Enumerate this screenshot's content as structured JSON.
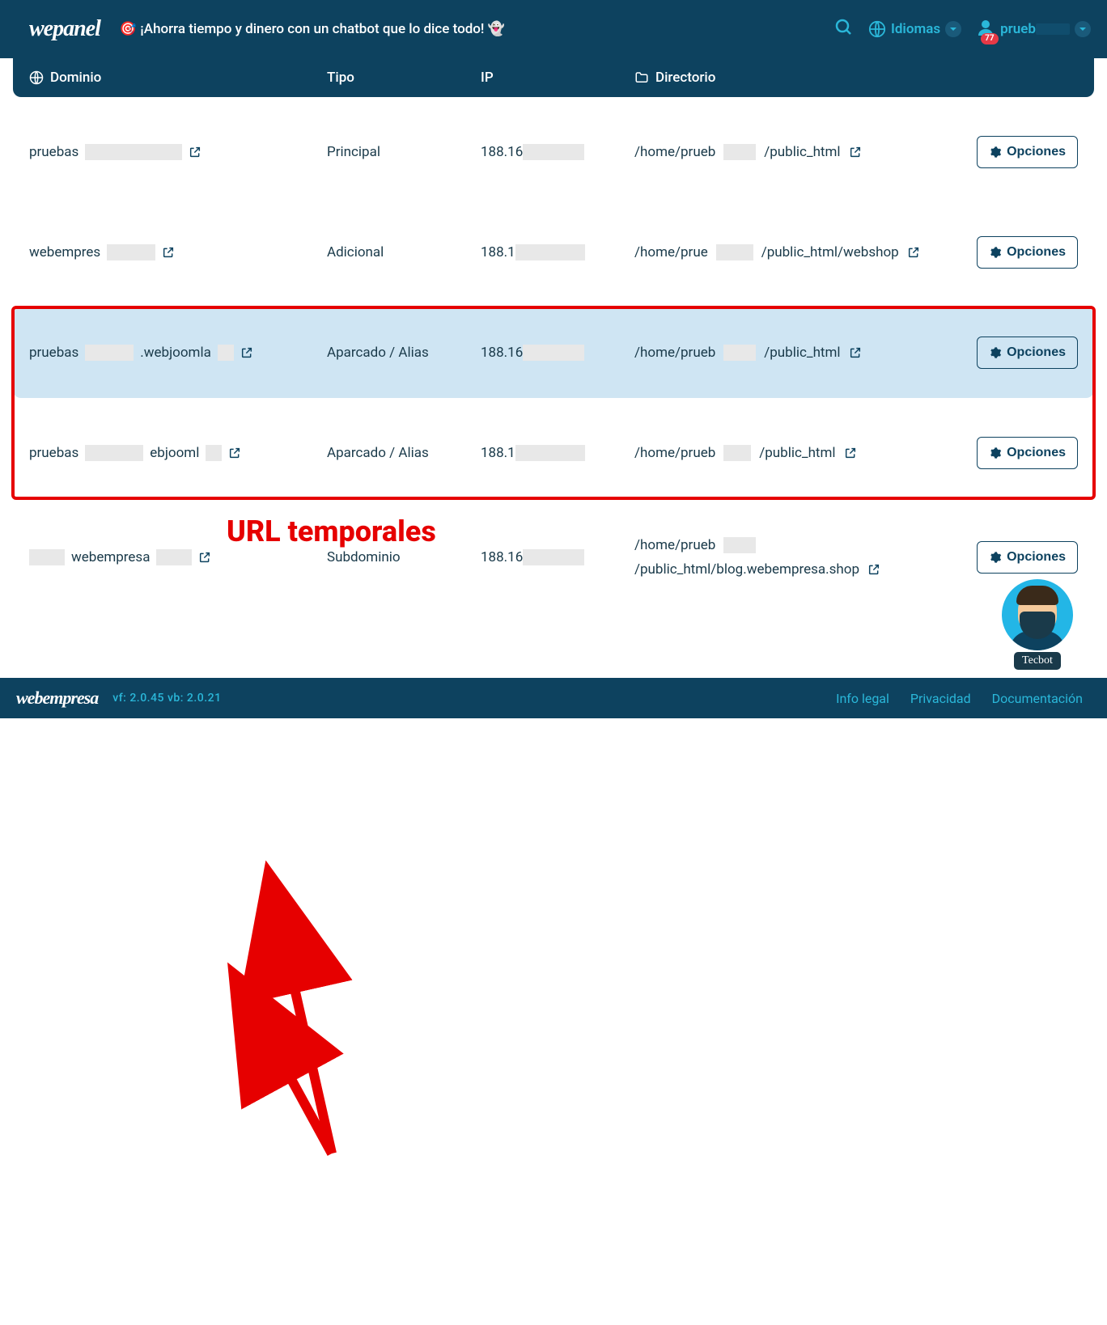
{
  "header": {
    "logo": "wepanel",
    "promo": "🎯 ¡Ahorra tiempo y dinero con un chatbot que lo dice todo! 👻",
    "languages_label": "Idiomas",
    "user_prefix": "prueb",
    "badge": "77"
  },
  "table": {
    "headers": {
      "domain": "Dominio",
      "type": "Tipo",
      "ip": "IP",
      "dir": "Directorio"
    },
    "rows": [
      {
        "domain_prefix": "pruebas",
        "domain_mask_w": 120,
        "type": "Principal",
        "ip_prefix": "188.16",
        "ip_mask_w": 76,
        "dir_prefix": "/home/prueb",
        "dir_mask_w": 40,
        "dir_suffix": "/public_html",
        "options": "Opciones"
      },
      {
        "domain_prefix": "webempres",
        "domain_mask_w": 60,
        "type": "Adicional",
        "ip_prefix": "188.1",
        "ip_mask_w": 86,
        "dir_prefix": "/home/prue",
        "dir_mask_w": 46,
        "dir_suffix": "/public_html/webshop",
        "options": "Opciones"
      },
      {
        "domain_prefix": "pruebas",
        "domain_mid_a": ".webjoomla",
        "domain_mask_w": 60,
        "domain_mask_w2": 20,
        "type": "Aparcado / Alias",
        "ip_prefix": "188.16",
        "ip_mask_w": 76,
        "dir_prefix": "/home/prueb",
        "dir_mask_w": 40,
        "dir_suffix": "/public_html",
        "options": "Opciones",
        "highlighted": true
      },
      {
        "domain_prefix": "pruebas",
        "domain_mid_a": "ebjooml",
        "domain_mask_w": 72,
        "domain_mask_w2": 20,
        "type": "Aparcado / Alias",
        "ip_prefix": "188.1",
        "ip_mask_w": 86,
        "dir_prefix": "/home/prueb",
        "dir_mask_w": 34,
        "dir_suffix": "/public_html",
        "options": "Opciones"
      },
      {
        "domain_lead_mask_w": 44,
        "domain_prefix": "webempresa",
        "domain_mask_w": 44,
        "type": "Subdominio",
        "ip_prefix": "188.16",
        "ip_mask_w": 76,
        "dir_prefix": "/home/prueb",
        "dir_mask_w": 40,
        "dir_suffix": "/public_html/blog.webempresa.shop",
        "options": "Opciones"
      }
    ]
  },
  "annotation": {
    "label": "URL temporales"
  },
  "tecbot": {
    "label": "Tecbot"
  },
  "footer": {
    "logo": "webempresa",
    "version": "vf: 2.0.45 vb: 2.0.21",
    "links": [
      "Info legal",
      "Privacidad",
      "Documentación"
    ]
  }
}
